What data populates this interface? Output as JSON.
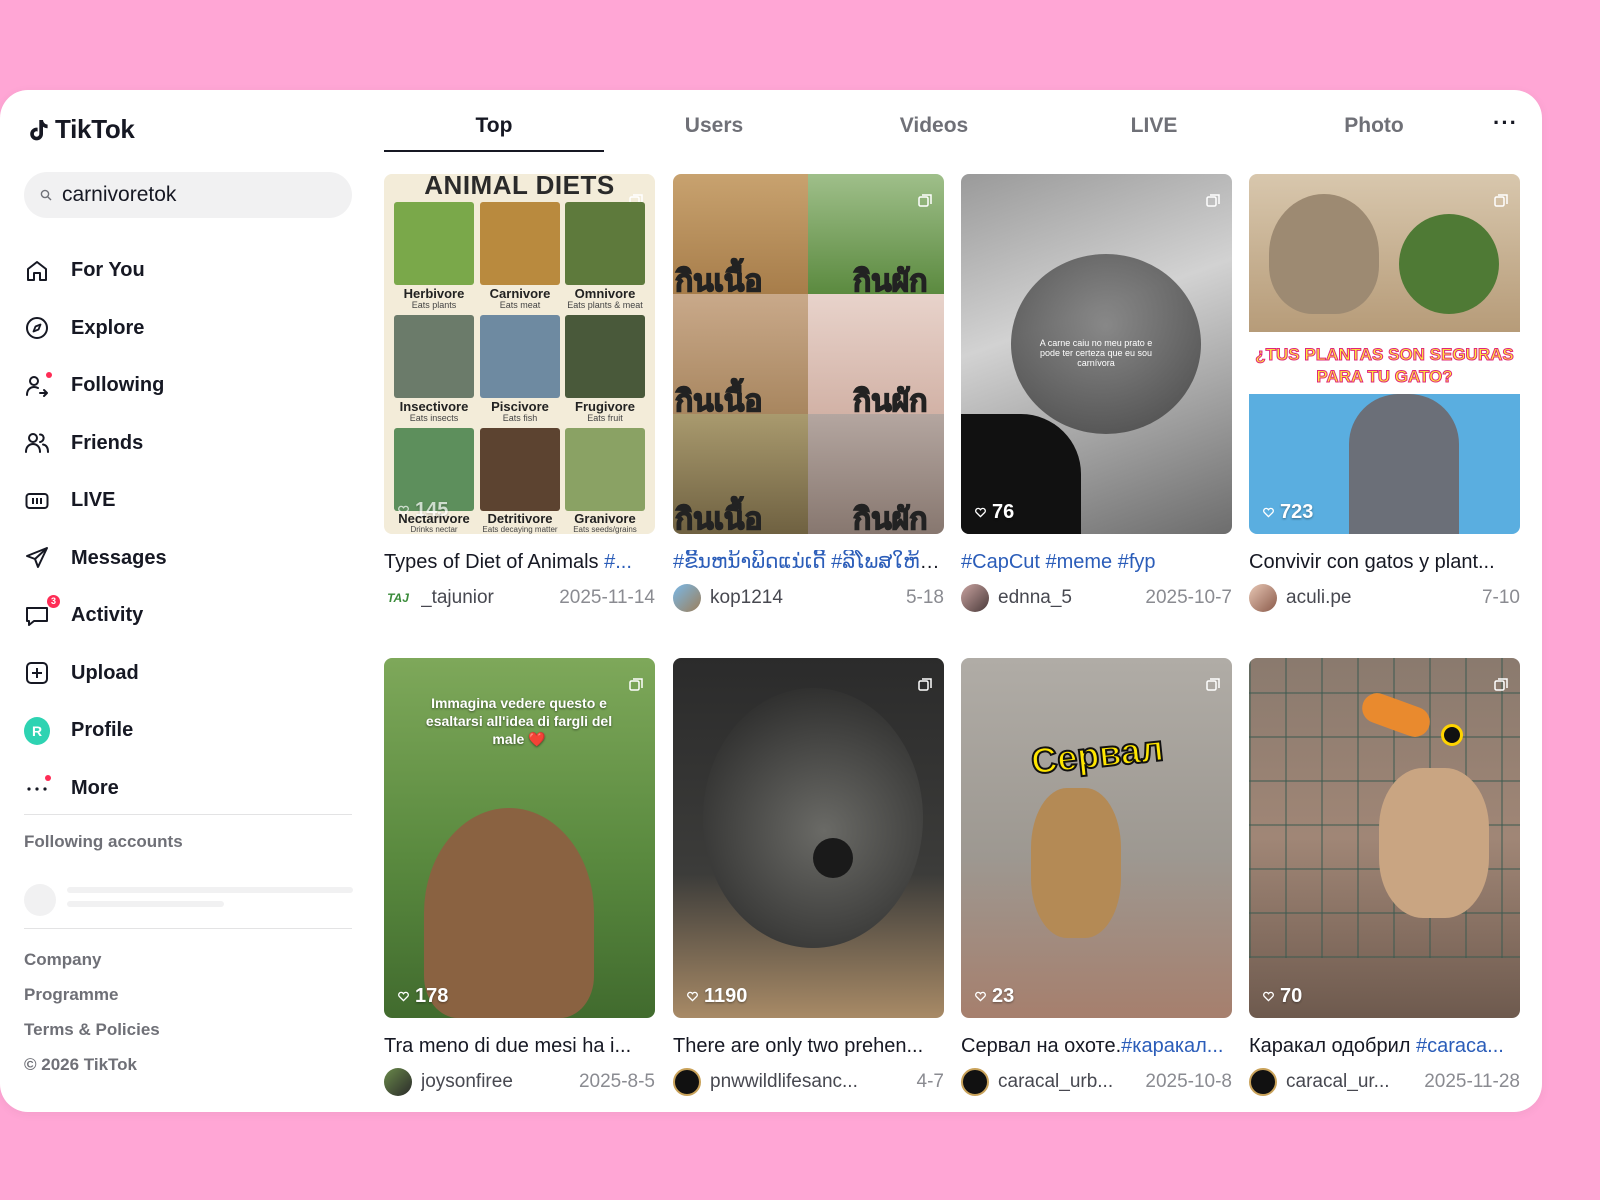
{
  "app": {
    "name": "TikTok"
  },
  "search": {
    "value": "carnivoretok"
  },
  "nav": {
    "items": [
      {
        "label": "For You",
        "icon": "home-icon"
      },
      {
        "label": "Explore",
        "icon": "compass-icon"
      },
      {
        "label": "Following",
        "icon": "following-icon"
      },
      {
        "label": "Friends",
        "icon": "friends-icon"
      },
      {
        "label": "LIVE",
        "icon": "live-icon"
      },
      {
        "label": "Messages",
        "icon": "send-icon"
      },
      {
        "label": "Activity",
        "icon": "activity-icon",
        "badge": "3"
      },
      {
        "label": "Upload",
        "icon": "upload-icon"
      },
      {
        "label": "Profile",
        "icon": "avatar",
        "avatar_letter": "R"
      },
      {
        "label": "More",
        "icon": "more-icon"
      }
    ]
  },
  "following_accounts": {
    "title": "Following accounts"
  },
  "footer": {
    "links": [
      "Company",
      "Programme",
      "Terms & Policies",
      "© 2026 TikTok"
    ]
  },
  "tabs": {
    "items": [
      "Top",
      "Users",
      "Videos",
      "LIVE",
      "Photo"
    ],
    "active": "Top",
    "more": "···"
  },
  "thumb_text": {
    "diets_title": "ANIMAL DIETS",
    "diets": [
      {
        "name": "Herbivore",
        "sub": "Eats plants"
      },
      {
        "name": "Carnivore",
        "sub": "Eats meat"
      },
      {
        "name": "Omnivore",
        "sub": "Eats plants & meat"
      },
      {
        "name": "Insectivore",
        "sub": "Eats insects"
      },
      {
        "name": "Piscivore",
        "sub": "Eats fish"
      },
      {
        "name": "Frugivore",
        "sub": "Eats fruit"
      },
      {
        "name": "Nectarivore",
        "sub": "Drinks nectar"
      },
      {
        "name": "Detritivore",
        "sub": "Eats decaying matter"
      },
      {
        "name": "Granivore",
        "sub": "Eats seeds/grains"
      }
    ],
    "thai_meat": "กินเนื้อ",
    "thai_veg": "กินผัก",
    "carne": "A carne caiu no meu prato e pode ter certeza que eu sou carnívora",
    "plantas": "¿TUS PLANTAS SON SEGURAS PARA TU GATO?",
    "immagina": "Immagina vedere questo e esaltarsi all'idea di fargli del male ❤️",
    "serval": "Сервал"
  },
  "videos": [
    {
      "caption": "Types of Diet of Animals ",
      "tag": "#...",
      "user": "_tajunior",
      "date": "2025-11-14",
      "likes": "145"
    },
    {
      "caption": "",
      "tag": "#ຂີ້ນຫນ້າພິດແນ່ເດີ້ #ລີໂພສໃຫ້ທອ...",
      "user": "kop1214",
      "date": "5-18",
      "likes": ""
    },
    {
      "caption": "",
      "tag": "#CapCut #meme #fyp",
      "user": "ednna_5",
      "date": "2025-10-7",
      "likes": "76"
    },
    {
      "caption": "Convivir con gatos y plant...",
      "tag": "",
      "user": "aculi.pe",
      "date": "7-10",
      "likes": "723"
    },
    {
      "caption": "Tra meno di due mesi ha i...",
      "tag": "",
      "user": "joysonfiree",
      "date": "2025-8-5",
      "likes": "178"
    },
    {
      "caption": "There are only two prehen...",
      "tag": "",
      "user": "pnwwildlifesanc...",
      "date": "4-7",
      "likes": "1190"
    },
    {
      "caption": "Сервал на охоте.",
      "tag": "#каракал...",
      "user": "caracal_urb...",
      "date": "2025-10-8",
      "likes": "23"
    },
    {
      "caption": "Каракал одобрил ",
      "tag": "#caraca...",
      "user": "caracal_ur...",
      "date": "2025-11-28",
      "likes": "70"
    }
  ],
  "colors": {
    "background": "#ffa6d5",
    "accent": "#fe2c55",
    "hashtag": "#2b5db9",
    "text": "#161823"
  }
}
